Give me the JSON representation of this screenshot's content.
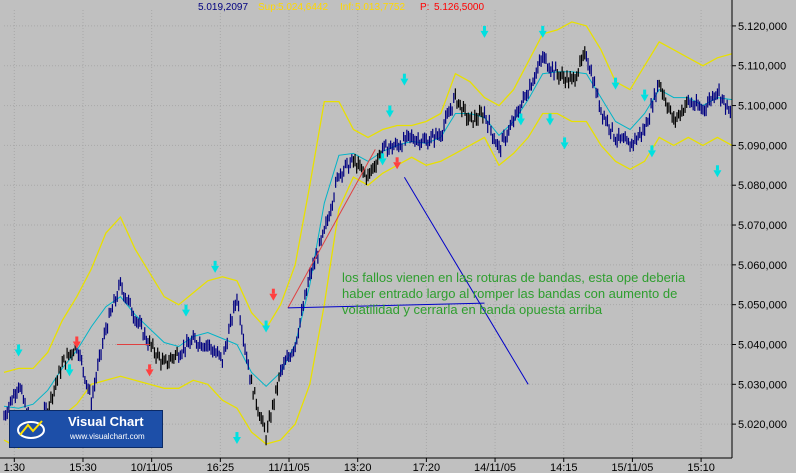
{
  "header": {
    "instrument": "",
    "last": "5.019,2097",
    "sup_label": "Sup:",
    "sup_value": "5.024,6442",
    "inf_label": "Inf:",
    "inf_value": "5.013,7752",
    "p_label": "P:",
    "p_value": "5.126,5000"
  },
  "annotation": "los fallos vienen en las roturas de bandas, esta ope deberia haber entrado largo al romper las bandas con aumento de volatilidad y cerrarla en banda opuesta arriba",
  "logo": {
    "title": "Visual Chart",
    "url": "www.visualchart.com"
  },
  "colors": {
    "background": "#c0c0c0",
    "price": "#000080",
    "price_alt": "#000000",
    "band": "#e8e000",
    "mid": "#00b4c8",
    "annotation_text": "#2e9e2e",
    "annotation_line": "#0000c8",
    "red_line": "#e04040",
    "buy_arrow": "#00e0e0",
    "sell_arrow": "#ff4040",
    "header_last": "#000080",
    "header_sup": "#ffd800",
    "header_inf": "#ffd800",
    "header_p": "#ff0000"
  },
  "chart_data": {
    "type": "line",
    "title": "",
    "xlabel": "",
    "ylabel": "",
    "ylim": [
      5013000,
      5124000
    ],
    "grid": true,
    "x_ticks": [
      "1:30",
      "15:30",
      "10/11/05",
      "16:25",
      "11/11/05",
      "13:20",
      "17:20",
      "14/11/05",
      "14:15",
      "15/11/05",
      "15:10"
    ],
    "y_ticks": [
      "5.020,000",
      "5.030,000",
      "5.040,000",
      "5.050,000",
      "5.060,000",
      "5.070,000",
      "5.080,000",
      "5.090,000",
      "5.100,000",
      "5.110,000",
      "5.120,000"
    ],
    "y_values": [
      5020000,
      5030000,
      5040000,
      5050000,
      5060000,
      5070000,
      5080000,
      5090000,
      5100000,
      5110000,
      5120000
    ],
    "price_x": [
      0,
      0.02,
      0.04,
      0.06,
      0.08,
      0.1,
      0.12,
      0.14,
      0.16,
      0.18,
      0.2,
      0.22,
      0.24,
      0.26,
      0.28,
      0.3,
      0.32,
      0.34,
      0.36,
      0.38,
      0.4,
      0.42,
      0.44,
      0.46,
      0.48,
      0.5,
      0.52,
      0.54,
      0.56,
      0.58,
      0.6,
      0.62,
      0.64,
      0.66,
      0.68,
      0.7,
      0.72,
      0.74,
      0.76,
      0.78,
      0.8,
      0.82,
      0.84,
      0.86,
      0.88,
      0.9,
      0.92,
      0.94,
      0.96,
      0.98,
      1.0
    ],
    "price": [
      5022000,
      5030000,
      5018000,
      5024000,
      5035000,
      5040000,
      5026000,
      5044000,
      5055000,
      5047000,
      5040000,
      5035000,
      5038000,
      5041000,
      5040000,
      5036000,
      5052000,
      5030000,
      5017000,
      5033000,
      5040000,
      5057000,
      5068000,
      5083000,
      5086000,
      5082000,
      5089000,
      5090000,
      5092000,
      5091000,
      5093000,
      5102000,
      5096000,
      5098000,
      5089000,
      5096000,
      5104000,
      5112000,
      5108000,
      5106000,
      5113000,
      5099000,
      5092000,
      5090000,
      5094000,
      5106000,
      5096000,
      5101000,
      5099000,
      5104000,
      5097000
    ],
    "band_upper": [
      5033000,
      5034000,
      5034000,
      5038000,
      5046000,
      5052000,
      5059000,
      5068000,
      5072000,
      5064000,
      5058000,
      5052000,
      5050000,
      5053000,
      5056000,
      5057000,
      5056000,
      5048000,
      5044000,
      5050000,
      5060000,
      5080000,
      5101000,
      5101000,
      5094000,
      5092000,
      5094000,
      5095000,
      5095000,
      5096000,
      5098000,
      5108000,
      5106000,
      5102000,
      5100000,
      5104000,
      5111000,
      5118000,
      5119000,
      5121000,
      5120000,
      5114000,
      5106000,
      5104000,
      5110000,
      5116000,
      5114000,
      5112000,
      5110000,
      5112000,
      5113000
    ],
    "band_lower": [
      5016000,
      5014000,
      5016000,
      5019000,
      5022000,
      5025000,
      5030000,
      5031000,
      5032000,
      5031000,
      5030000,
      5029000,
      5029000,
      5031000,
      5030000,
      5026000,
      5024000,
      5018000,
      5015000,
      5016000,
      5020000,
      5030000,
      5050000,
      5074000,
      5082000,
      5080000,
      5083000,
      5085000,
      5087000,
      5085000,
      5086000,
      5088000,
      5090000,
      5092000,
      5085000,
      5088000,
      5092000,
      5098000,
      5098000,
      5096000,
      5096000,
      5090000,
      5086000,
      5084000,
      5086000,
      5092000,
      5090000,
      5092000,
      5090000,
      5092000,
      5090000
    ]
  }
}
